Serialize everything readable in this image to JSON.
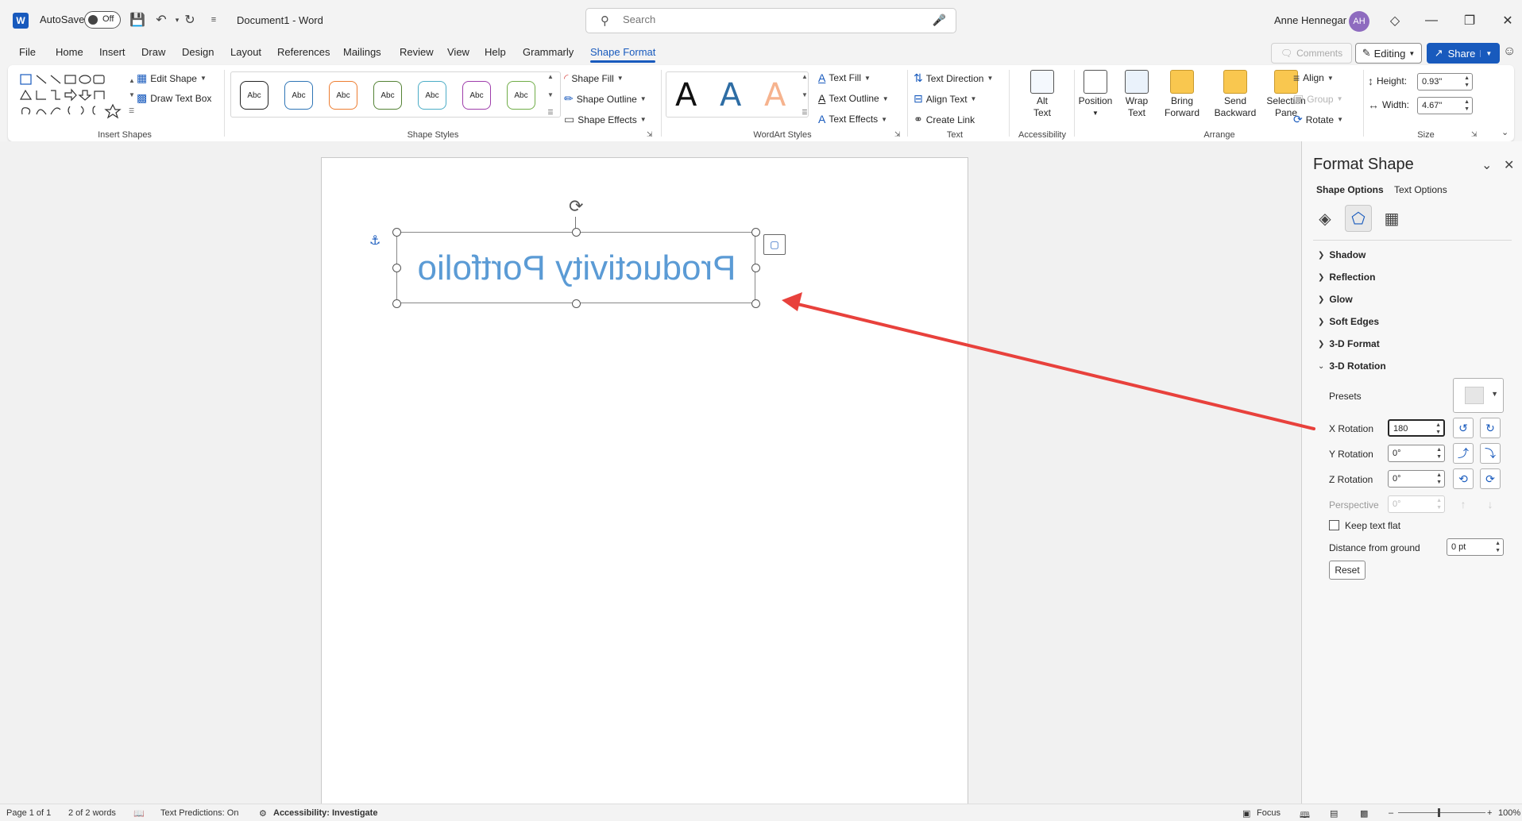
{
  "titlebar": {
    "app_letter": "W",
    "autosave_label": "AutoSave",
    "autosave_state": "Off",
    "document_title": "Document1  -  Word",
    "search_placeholder": "Search",
    "user_name": "Anne Hennegar",
    "user_initials": "AH"
  },
  "menu": {
    "tabs": [
      "File",
      "Home",
      "Insert",
      "Draw",
      "Design",
      "Layout",
      "References",
      "Mailings",
      "Review",
      "View",
      "Help",
      "Grammarly",
      "Shape Format"
    ],
    "active_tab": "Shape Format",
    "comments_label": "Comments",
    "editing_label": "Editing",
    "share_label": "Share"
  },
  "ribbon": {
    "insert_shapes": {
      "label": "Insert Shapes",
      "edit_shape": "Edit Shape",
      "draw_text_box": "Draw Text Box"
    },
    "shape_styles": {
      "label": "Shape Styles",
      "style_text": "Abc",
      "style_colors": [
        "#222222",
        "#2e75b6",
        "#ed7d31",
        "#548235",
        "#4bacc6",
        "#9e3dab",
        "#70ad47"
      ],
      "shape_fill": "Shape Fill",
      "shape_outline": "Shape Outline",
      "shape_effects": "Shape Effects"
    },
    "wordart_styles": {
      "label": "WordArt Styles",
      "letter": "A",
      "text_fill": "Text Fill",
      "text_outline": "Text Outline",
      "text_effects": "Text Effects"
    },
    "text": {
      "label": "Text",
      "text_direction": "Text Direction",
      "align_text": "Align Text",
      "create_link": "Create Link"
    },
    "accessibility": {
      "label": "Accessibility",
      "alt_text_line1": "Alt",
      "alt_text_line2": "Text"
    },
    "arrange": {
      "label": "Arrange",
      "position": "Position",
      "wrap_text_line1": "Wrap",
      "wrap_text_line2": "Text",
      "bring_forward_line1": "Bring",
      "bring_forward_line2": "Forward",
      "send_backward_line1": "Send",
      "send_backward_line2": "Backward",
      "selection_pane_line1": "Selection",
      "selection_pane_line2": "Pane",
      "align": "Align",
      "group": "Group",
      "rotate": "Rotate"
    },
    "size": {
      "label": "Size",
      "height_label": "Height:",
      "height_value": "0.93\"",
      "width_label": "Width:",
      "width_value": "4.67\""
    }
  },
  "document": {
    "textbox_text": "Productivity Portfolio"
  },
  "format_pane": {
    "title": "Format Shape",
    "tab_shape_options": "Shape Options",
    "tab_text_options": "Text Options",
    "sections": [
      "Shadow",
      "Reflection",
      "Glow",
      "Soft Edges",
      "3-D Format"
    ],
    "expanded_section": "3-D Rotation",
    "presets_label": "Presets",
    "x_rotation_label": "X Rotation",
    "x_rotation_value": "180",
    "y_rotation_label": "Y Rotation",
    "y_rotation_value": "0°",
    "z_rotation_label": "Z Rotation",
    "z_rotation_value": "0°",
    "perspective_label": "Perspective",
    "perspective_value": "0°",
    "keep_text_flat_label": "Keep text flat",
    "distance_label": "Distance from ground",
    "distance_value": "0 pt",
    "reset_label": "Reset"
  },
  "statusbar": {
    "page": "Page 1 of 1",
    "words": "2 of 2 words",
    "text_predictions": "Text Predictions: On",
    "accessibility": "Accessibility: Investigate",
    "focus": "Focus",
    "zoom": "100%"
  },
  "colors": {
    "accent": "#185abd",
    "arrow": "#e8413c",
    "textbox_text": "#5b9bd5"
  }
}
